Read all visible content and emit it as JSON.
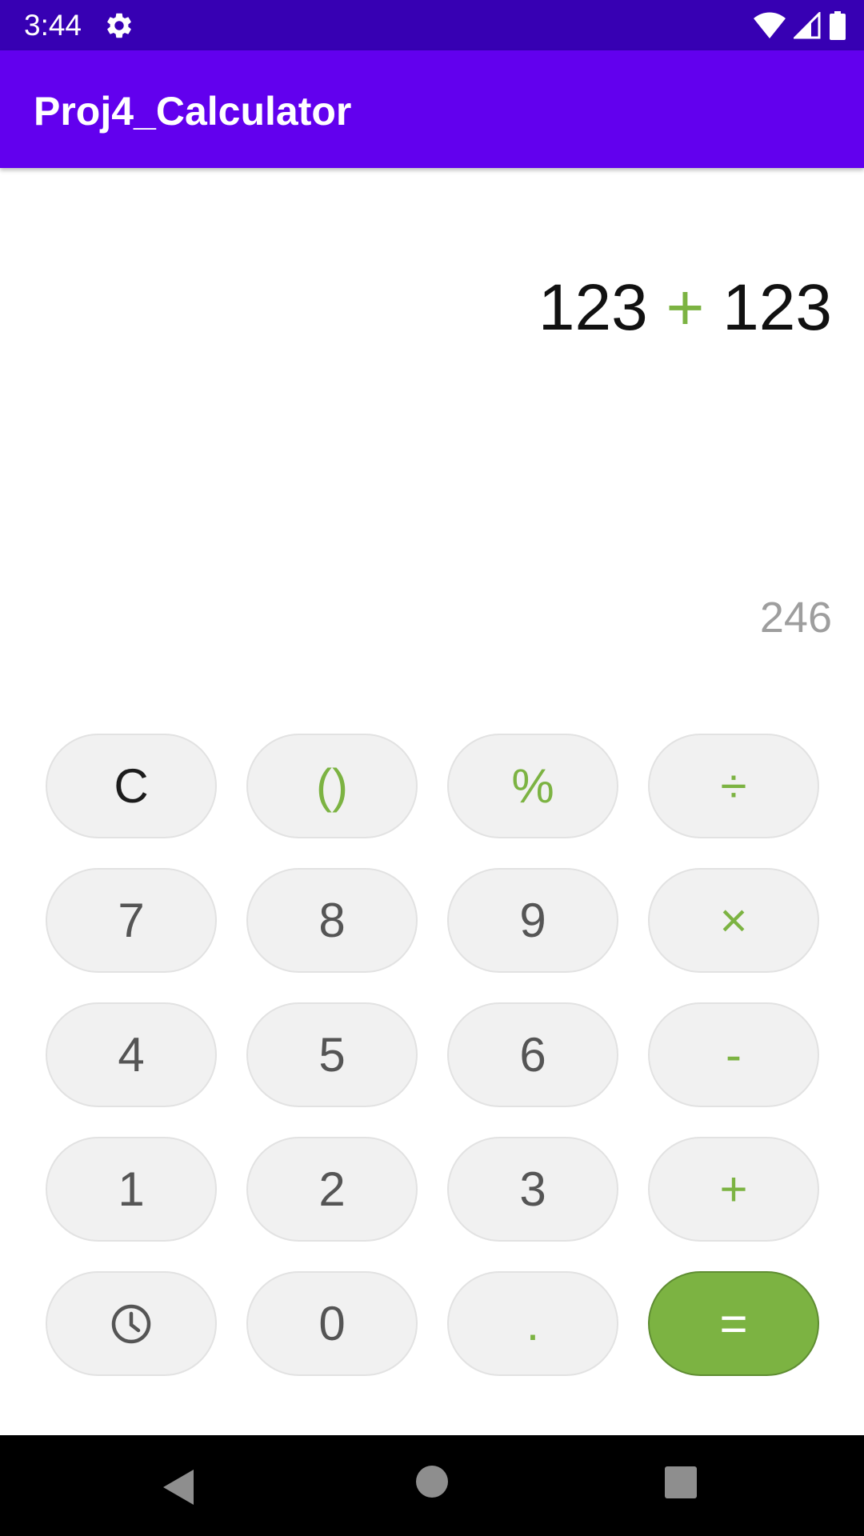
{
  "status_bar": {
    "time": "3:44",
    "icons": [
      "settings-icon",
      "wifi-icon",
      "cellular-signal-icon",
      "battery-icon"
    ]
  },
  "app_bar": {
    "title": "Proj4_Calculator",
    "color": "#6200ee"
  },
  "display": {
    "expression": {
      "left_operand": "123",
      "operator": "+",
      "right_operand": "123"
    },
    "result": "246"
  },
  "keypad": {
    "rows": [
      [
        "C",
        "()",
        "%",
        "÷"
      ],
      [
        "7",
        "8",
        "9",
        "×"
      ],
      [
        "4",
        "5",
        "6",
        "-"
      ],
      [
        "1",
        "2",
        "3",
        "+"
      ],
      [
        "history-icon",
        "0",
        ".",
        "="
      ]
    ],
    "accent_color": "#7cb342"
  },
  "nav_bar": {
    "icons": [
      "back-icon",
      "home-icon",
      "recents-icon"
    ]
  }
}
